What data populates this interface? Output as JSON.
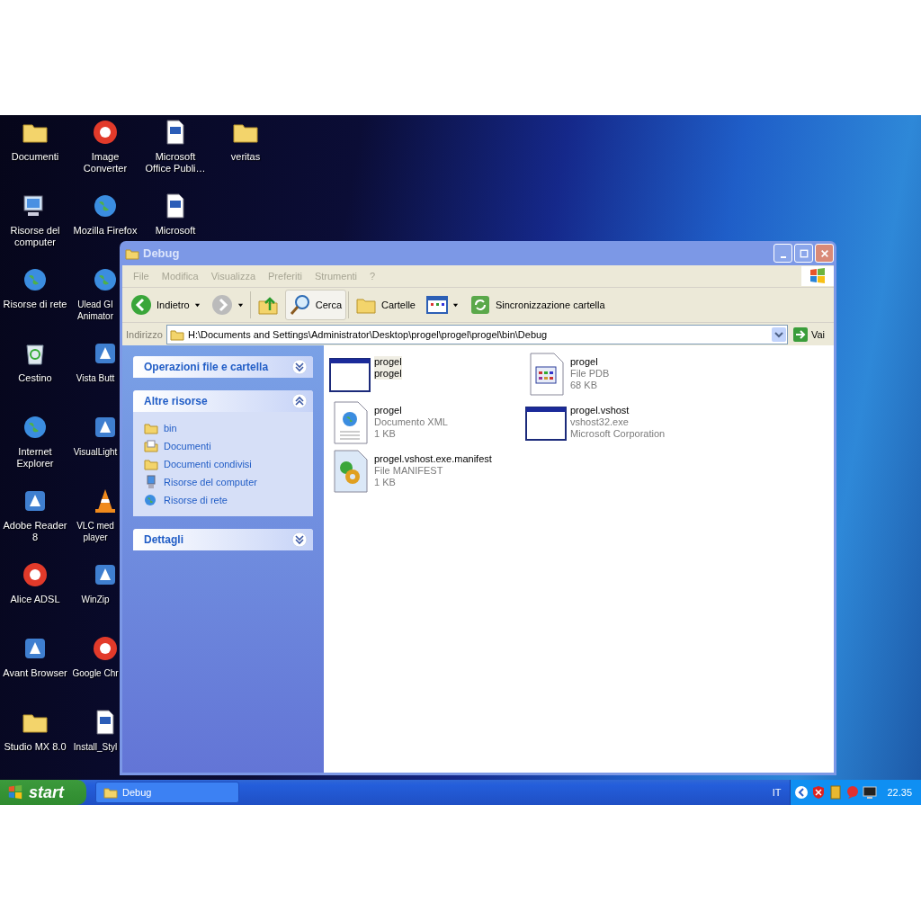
{
  "desktop_columns": [
    [
      {
        "label": "Documenti",
        "kind": "folder"
      },
      {
        "label": "Risorse del computer",
        "kind": "computer"
      },
      {
        "label": "Risorse di rete",
        "kind": "globe"
      },
      {
        "label": "Cestino",
        "kind": "bin"
      },
      {
        "label": "Internet Explorer",
        "kind": "globe"
      },
      {
        "label": "Adobe Reader 8",
        "kind": "app"
      },
      {
        "label": "Alice ADSL",
        "kind": "logo"
      },
      {
        "label": "Avant Browser",
        "kind": "app"
      },
      {
        "label": "Studio MX 8.0",
        "kind": "folder"
      }
    ],
    [
      {
        "label": "Image Converter",
        "kind": "logo"
      },
      {
        "label": "Mozilla Firefox",
        "kind": "globe"
      },
      {
        "label": "Ulead GI Animator",
        "kind": "globe"
      },
      {
        "label": "Vista Butt",
        "kind": "app"
      },
      {
        "label": "VisualLight",
        "kind": "app"
      },
      {
        "label": "VLC med player",
        "kind": "cone"
      },
      {
        "label": "WinZip",
        "kind": "app"
      },
      {
        "label": "Google Chr",
        "kind": "logo"
      },
      {
        "label": "Install_Styl",
        "kind": "document"
      }
    ],
    [
      {
        "label": "Microsoft Office Publi…",
        "kind": "document"
      },
      {
        "label": "Microsoft",
        "kind": "document"
      }
    ],
    [
      {
        "label": "veritas",
        "kind": "folder"
      }
    ]
  ],
  "window": {
    "title": "Debug",
    "active": false,
    "menu": [
      "File",
      "Modifica",
      "Visualizza",
      "Preferiti",
      "Strumenti",
      "?"
    ],
    "toolbar": [
      {
        "label": "Indietro",
        "kind": "back",
        "dropdown": true,
        "highlighted": false
      },
      {
        "kind": "forward",
        "dropdown": true,
        "highlighted": false
      },
      {
        "kind": "up",
        "dropdown": false,
        "highlighted": false
      },
      {
        "label": "Cerca",
        "kind": "search",
        "dropdown": false,
        "highlighted": true
      },
      {
        "label": "Cartelle",
        "kind": "folders",
        "dropdown": false,
        "highlighted": false
      },
      {
        "kind": "views",
        "dropdown": true,
        "highlighted": false
      },
      {
        "label": "Sincronizzazione cartella",
        "kind": "sync",
        "dropdown": false,
        "highlighted": false
      }
    ],
    "address": {
      "label": "Indirizzo",
      "value": "H:\\Documents and Settings\\Administrator\\Desktop\\progel\\progel\\progel\\bin\\Debug",
      "go": "Vai"
    },
    "panels": [
      {
        "title": "Operazioni file e cartella",
        "expanded": false
      },
      {
        "title": "Altre risorse",
        "expanded": true,
        "items": [
          {
            "label": "bin",
            "kind": "folder"
          },
          {
            "label": "Documenti",
            "kind": "docs"
          },
          {
            "label": "Documenti condivisi",
            "kind": "folder"
          },
          {
            "label": "Risorse del computer",
            "kind": "computer"
          },
          {
            "label": "Risorse di rete",
            "kind": "network"
          }
        ]
      },
      {
        "title": "Dettagli",
        "expanded": false
      }
    ],
    "files": [
      {
        "name": "progel",
        "lines": [
          "progel"
        ],
        "kind": "window",
        "selected": true
      },
      {
        "name": "progel",
        "lines": [
          "File PDB",
          "68 KB"
        ],
        "kind": "pdb",
        "selected": false
      },
      {
        "name": "progel",
        "lines": [
          "Documento XML",
          "1 KB"
        ],
        "kind": "xml",
        "selected": false
      },
      {
        "name": "progel.vshost",
        "lines": [
          "vshost32.exe",
          "Microsoft Corporation"
        ],
        "kind": "window",
        "selected": false
      },
      {
        "name": "progel.vshost.exe.manifest",
        "lines": [
          "File MANIFEST",
          "1 KB"
        ],
        "kind": "manifest",
        "selected": false
      }
    ]
  },
  "taskbar": {
    "start": "start",
    "tasks": [
      "Debug"
    ],
    "language": "IT",
    "clock": "22.35"
  }
}
